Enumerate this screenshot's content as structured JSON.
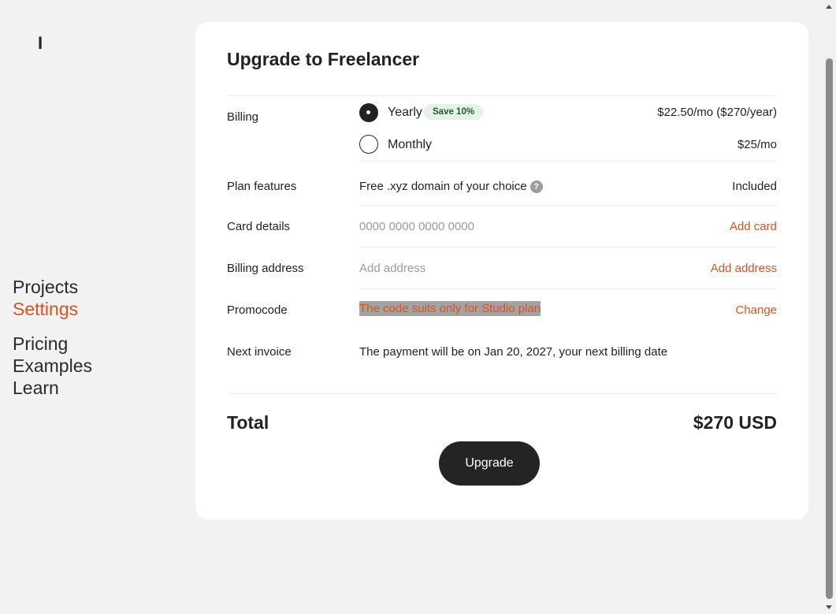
{
  "logo": {
    "text": "I"
  },
  "nav": {
    "items": [
      {
        "label": "Projects"
      },
      {
        "label": "Settings"
      },
      {
        "label": "Pricing"
      },
      {
        "label": "Examples"
      },
      {
        "label": "Learn"
      }
    ]
  },
  "card": {
    "title": "Upgrade to Freelancer",
    "billing": {
      "label": "Billing",
      "yearly": {
        "label": "Yearly",
        "badge": "Save 10%",
        "price": "$22.50/mo ($270/year)",
        "selected": true
      },
      "monthly": {
        "label": "Monthly",
        "price": "$25/mo",
        "selected": false
      }
    },
    "features": {
      "label": "Plan features",
      "text": "Free .xyz domain of your choice",
      "help": "?",
      "status": "Included"
    },
    "card_details": {
      "label": "Card details",
      "placeholder": "0000 0000 0000 0000",
      "action": "Add card"
    },
    "billing_address": {
      "label": "Billing address",
      "placeholder": "Add address",
      "action": "Add address"
    },
    "promocode": {
      "label": "Promocode",
      "message": "The code suits only for Studio plan",
      "action": "Change"
    },
    "next_invoice": {
      "label": "Next invoice",
      "text": "The payment will be on Jan 20, 2027, your next billing date"
    },
    "total": {
      "label": "Total",
      "value": "$270 USD"
    },
    "upgrade_button": "Upgrade"
  },
  "colors": {
    "accent": "#d9531e",
    "button": "#242424",
    "badge_bg": "#e4f3e4"
  }
}
